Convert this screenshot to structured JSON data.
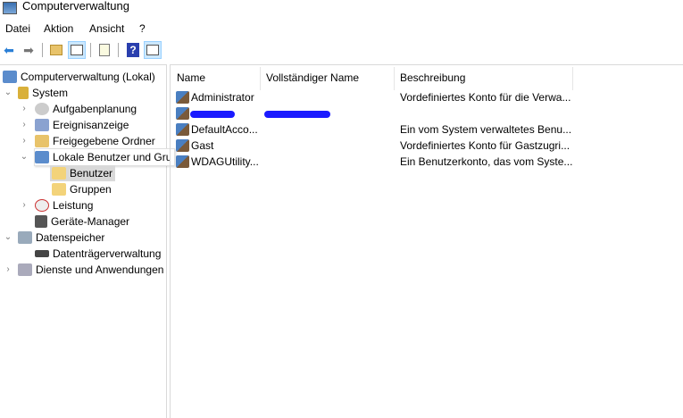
{
  "window": {
    "title": "Computerverwaltung",
    "icon": "computer-management-icon"
  },
  "menu": [
    "Datei",
    "Aktion",
    "Ansicht",
    "?"
  ],
  "toolbar": {
    "icons": [
      "back-arrow-icon",
      "forward-arrow-icon",
      "up-folder-icon",
      "show-hide-tree-icon",
      "export-list-icon",
      "help-icon",
      "show-hide-action-pane-icon"
    ],
    "help_glyph": "?"
  },
  "tree": [
    {
      "label": "Computerverwaltung (Lokal)"
    },
    {
      "label": "System"
    },
    {
      "label": "Aufgabenplanung"
    },
    {
      "label": "Ereignisanzeige"
    },
    {
      "label": "Freigegebene Ordner"
    },
    {
      "label": "Lokale Benutzer und Gruppen"
    },
    {
      "label": "Benutzer"
    },
    {
      "label": "Gruppen"
    },
    {
      "label": "Leistung"
    },
    {
      "label": "Geräte-Manager"
    },
    {
      "label": "Datenspeicher"
    },
    {
      "label": "Datenträgerverwaltung"
    },
    {
      "label": "Dienste und Anwendungen"
    }
  ],
  "list": {
    "columns": [
      "Name",
      "Vollständiger Name",
      "Beschreibung"
    ],
    "rows": [
      {
        "name": "Administrator",
        "full": "",
        "desc": "Vordefiniertes Konto für die Verwa..."
      },
      {
        "name": "",
        "full": "",
        "desc": "",
        "redacted": true
      },
      {
        "name": "DefaultAcco...",
        "full": "",
        "desc": "Ein vom System verwaltetes Benu..."
      },
      {
        "name": "Gast",
        "full": "",
        "desc": "Vordefiniertes Konto für Gastzugri..."
      },
      {
        "name": "WDAGUtility...",
        "full": "",
        "desc": "Ein Benutzerkonto, das vom Syste..."
      }
    ]
  },
  "colors": {
    "selection": "#d9d9d9",
    "toolbar_active": "#cce8ff",
    "redaction": "#1a1aff"
  }
}
